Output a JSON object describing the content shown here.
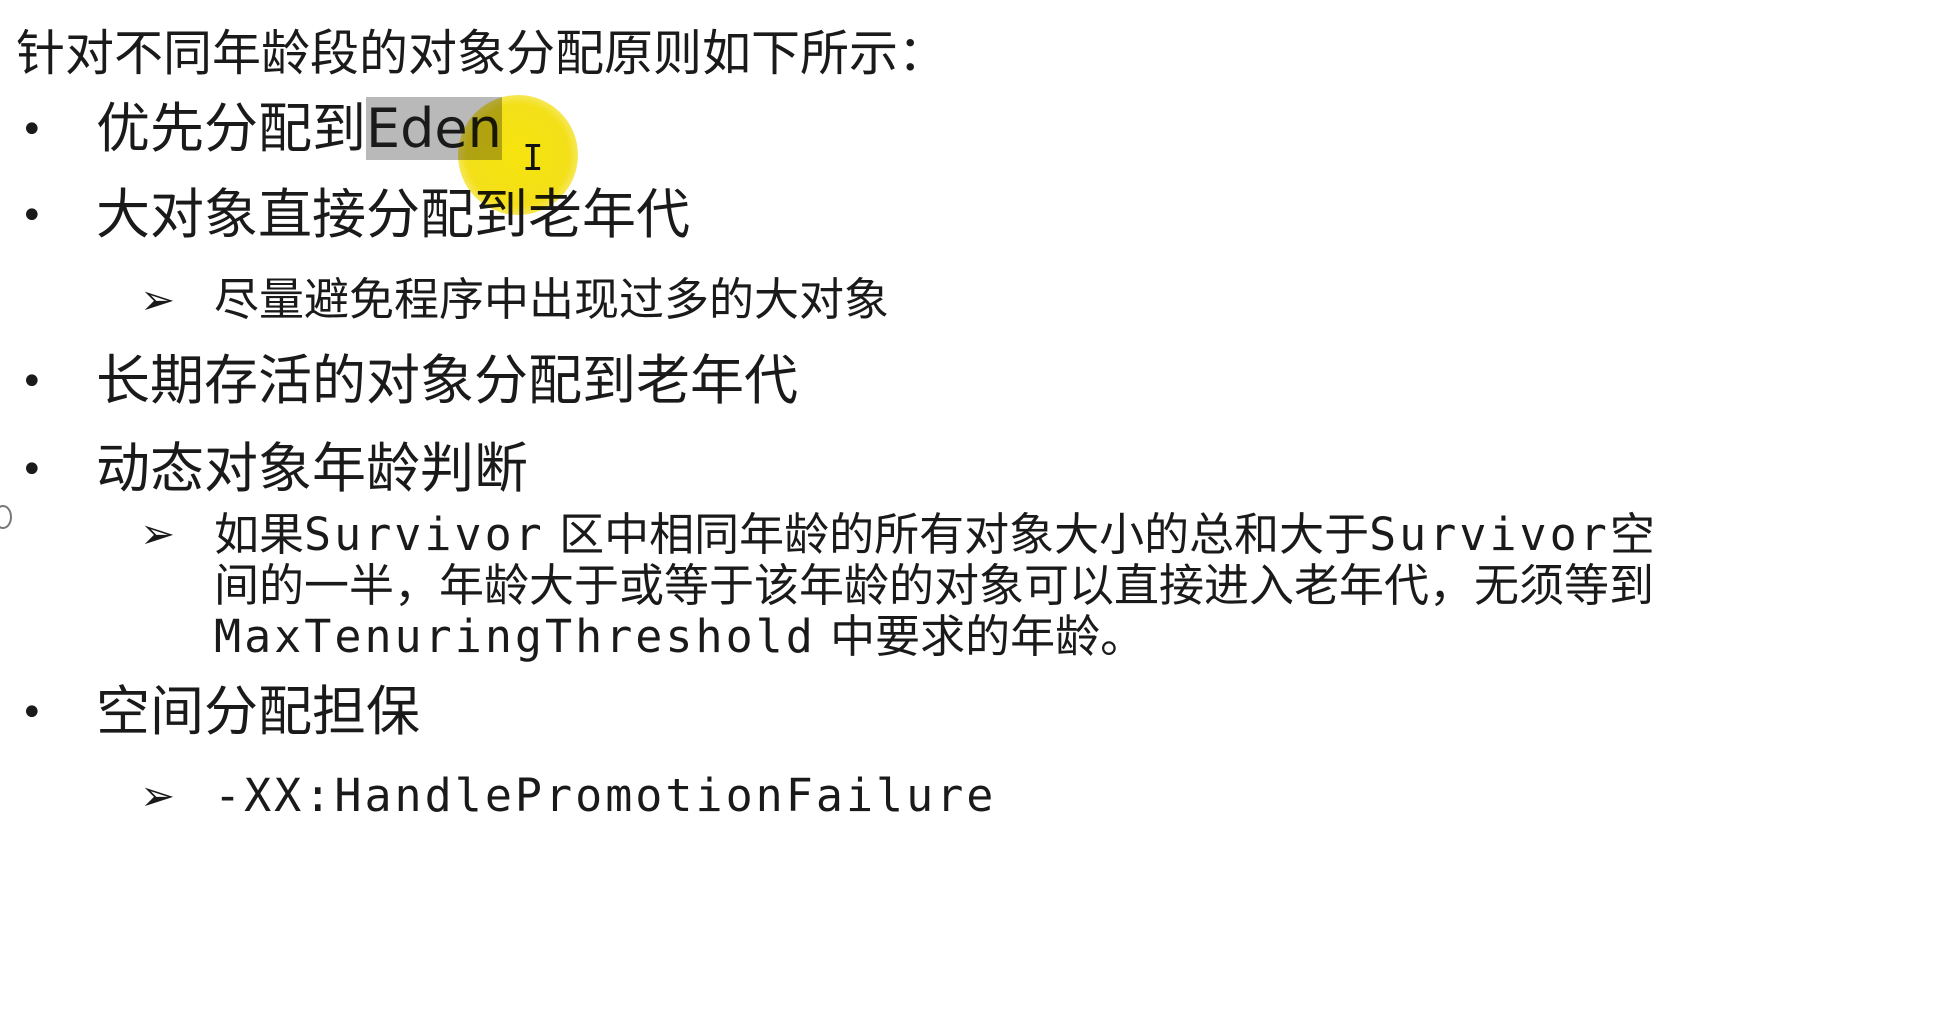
{
  "intro": "针对不同年龄段的对象分配原则如下所示：",
  "symbols": {
    "bullet": "•",
    "arrow": "➢",
    "cursor": "I"
  },
  "items": [
    {
      "prefix": "优先分配到",
      "highlight": "Eden"
    },
    {
      "text": "大对象直接分配到老年代",
      "sub": "尽量避免程序中出现过多的大对象"
    },
    {
      "text": "长期存活的对象分配到老年代"
    },
    {
      "text": "动态对象年龄判断",
      "sub_parts": {
        "a": "如果",
        "b": "Survivor",
        "c": " 区中相同年龄的所有对象大小的总和大于",
        "d": "Survivor",
        "e": "空",
        "line2": "间的一半，年龄大于或等于该年龄的对象可以直接进入老年代，无须等到",
        "line3_code": "MaxTenuringThreshold",
        "line3_rest": " 中要求的年龄。"
      }
    },
    {
      "text": "空间分配担保",
      "sub": "-XX:HandlePromotionFailure"
    }
  ],
  "colors": {
    "highlight_bg": "#b9b9b9",
    "cursor_spot": "#f3dd00",
    "text": "#1a1a1a"
  }
}
